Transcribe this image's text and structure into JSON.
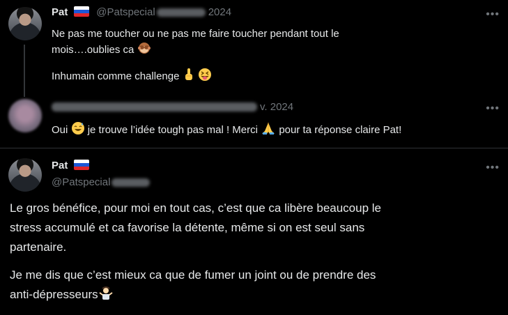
{
  "tweet1": {
    "display_name": "Pat",
    "handle": "@Patspecial",
    "date_suffix": "2024",
    "line1": "Ne pas me toucher ou ne pas me faire toucher pendant tout le",
    "line2": "mois….oublies ca",
    "line3": "Inhumain comme challenge",
    "more_label": "•••"
  },
  "tweet2": {
    "date_suffix": "v. 2024",
    "text_a": "Oui",
    "text_b": "je trouve l’idée tough pas mal ! Merci",
    "text_c": "pour ta réponse claire Pat!",
    "more_label": "•••"
  },
  "tweet3": {
    "display_name": "Pat",
    "handle": "@Patspecial",
    "para1_line1": "Le gros bénéfice, pour moi en tout cas, c’est que ca libère beaucoup le",
    "para1_line2": "stress accumulé et ca favorise la détente, même si on est seul sans",
    "para1_line3": "partenaire.",
    "para2_line1": "Je me dis que c’est mieux ca que de fumer un joint ou de prendre des",
    "para2_line2": "anti-dépresseurs",
    "more_label": "•••"
  },
  "icons": [
    "flag-russia-icon",
    "see-no-evil-monkey-icon",
    "index-pointing-up-icon",
    "squinting-tongue-face-icon",
    "grinning-sweat-face-icon",
    "folded-hands-icon",
    "person-shrugging-icon",
    "more-icon"
  ]
}
